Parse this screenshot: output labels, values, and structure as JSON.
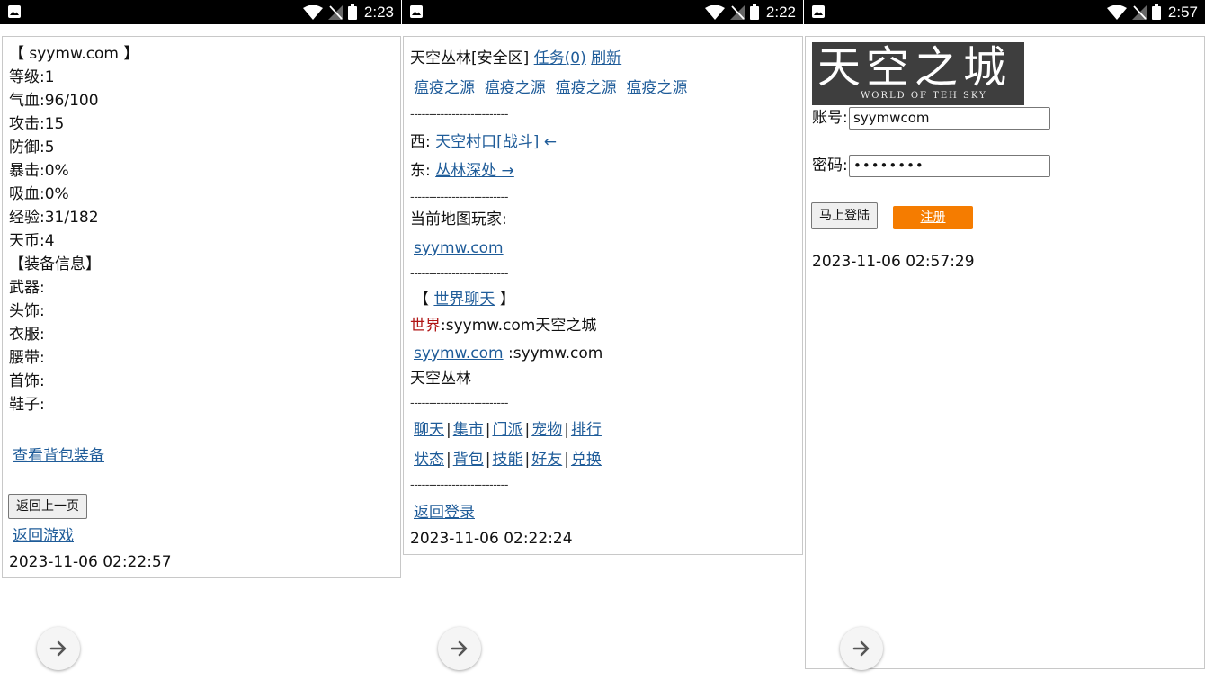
{
  "screens": [
    {
      "time": "2:23",
      "lines": [
        "【 syymw.com 】",
        "等级:1",
        "气血:96/100",
        "攻击:15",
        "防御:5",
        "暴击:0%",
        "吸血:0%",
        "经验:31/182",
        "天币:4",
        "【装备信息】",
        "武器:",
        "头饰:",
        "衣服:",
        "腰带:",
        "首饰:",
        "鞋子:"
      ],
      "bag_link": "查看背包装备",
      "back_button": "返回上一页",
      "return_game": "返回游戏",
      "timestamp": "2023-11-06 02:22:57"
    },
    {
      "time": "2:22",
      "location": "天空丛林[安全区]",
      "task_link": "任务(0)",
      "refresh_link": "刷新",
      "monsters": [
        "瘟疫之源",
        "瘟疫之源",
        "瘟疫之源",
        "瘟疫之源"
      ],
      "separator": "--------------------------",
      "west_label": "西:",
      "west_link": "天空村口[战斗] ←",
      "east_label": "东:",
      "east_link": "丛林深处 →",
      "players_label": "当前地图玩家:",
      "player_link": "syymw.com",
      "world_chat_open": "【",
      "world_chat_link": "世界聊天",
      "world_chat_close": "】",
      "chat_prefix": "世界",
      "chat_msg1": ":syymw.com天空之城",
      "chat_user": "syymw.com",
      "chat_msg2": ":syymw.com",
      "chat_msg3": "天空丛林",
      "menu_row1": [
        "聊天",
        "集市",
        "门派",
        "宠物",
        "排行"
      ],
      "menu_row2": [
        "状态",
        "背包",
        "技能",
        "好友",
        "兑换"
      ],
      "pipe": "|",
      "return_login": "返回登录",
      "timestamp": "2023-11-06 02:22:24"
    },
    {
      "time": "2:57",
      "logo_cn": "天空之城",
      "logo_en": "WORLD OF TEH SKY",
      "account_label": "账号:",
      "account_value": "syymwcom",
      "password_label": "密码:",
      "password_value": "••••••••",
      "login_button": "马上登陆",
      "register_button": "注册",
      "timestamp": "2023-11-06 02:57:29"
    }
  ]
}
